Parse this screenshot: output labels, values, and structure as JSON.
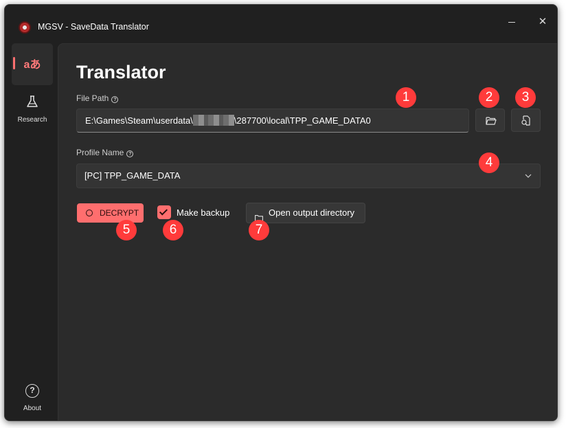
{
  "window": {
    "title": "MGSV - SaveData Translator",
    "minimize_glyph": "",
    "close_glyph": "✕"
  },
  "nav": {
    "translator": {
      "icon_text": "aあ",
      "icon": "translate-icon"
    },
    "research": {
      "label": "Research",
      "icon": "flask-icon"
    },
    "about": {
      "label": "About",
      "icon_text": "?",
      "icon": "help-circle-icon"
    }
  },
  "main": {
    "title": "Translator",
    "file_path": {
      "label": "File Path",
      "help_glyph": "?",
      "value": "E:\\Games\\Steam\\userdata\\",
      "value_suffix": "\\287700\\local\\TPP_GAME_DATA0",
      "browse_icon": "folder-open-icon",
      "search_icon": "file-search-icon"
    },
    "profile": {
      "label": "Profile Name",
      "help_glyph": "?",
      "selected": "[PC] TPP_GAME_DATA",
      "chevron": "chevron-down-icon"
    },
    "actions": {
      "decrypt_label": "DECRYPT",
      "backup_label": "Make backup",
      "backup_checked": true,
      "open_output_label": "Open output directory"
    }
  },
  "annotations": [
    "1",
    "2",
    "3",
    "4",
    "5",
    "6",
    "7"
  ],
  "colors": {
    "accent": "#ff6e6e",
    "badge": "#ff3b3b",
    "background": "#202020",
    "panel": "#2b2b2b"
  }
}
